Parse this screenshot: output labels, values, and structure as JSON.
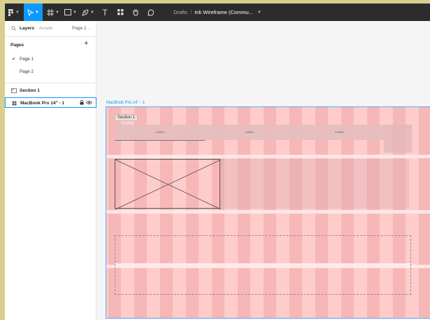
{
  "toolbar": {
    "file_path_project": "Drafts",
    "file_path_separator": "/",
    "file_name": "Ink Wireframe (Commu...",
    "tools": [
      "figma-menu-icon",
      "move-tool-icon",
      "frame-tool-icon",
      "shape-tool-icon",
      "pen-tool-icon",
      "text-tool-icon",
      "resources-icon",
      "hand-tool-icon",
      "comment-icon"
    ],
    "text_tool_glyph": "T",
    "active_tool": "move-tool-icon",
    "accent": "#0d99ff"
  },
  "panel": {
    "tabs": {
      "layers": "Layers",
      "assets": "Assets",
      "page": "Page 1"
    },
    "pages_header": "Pages",
    "add_symbol": "+",
    "pages": [
      {
        "label": "Page 1",
        "current": true
      },
      {
        "label": "Page 2",
        "current": false
      }
    ],
    "layers": [
      {
        "label": "Section 1",
        "icon": "section-icon",
        "selected": false
      },
      {
        "label": "MacBook Pro 14\" - 1",
        "icon": "frame-grid-icon",
        "selected": true
      }
    ]
  },
  "canvas": {
    "frame_label": "MacBook Pro 14\" - 1",
    "section_label": "Section 1",
    "nav_labels": [
      "LABEL",
      "LABEL",
      "LABEL"
    ]
  }
}
